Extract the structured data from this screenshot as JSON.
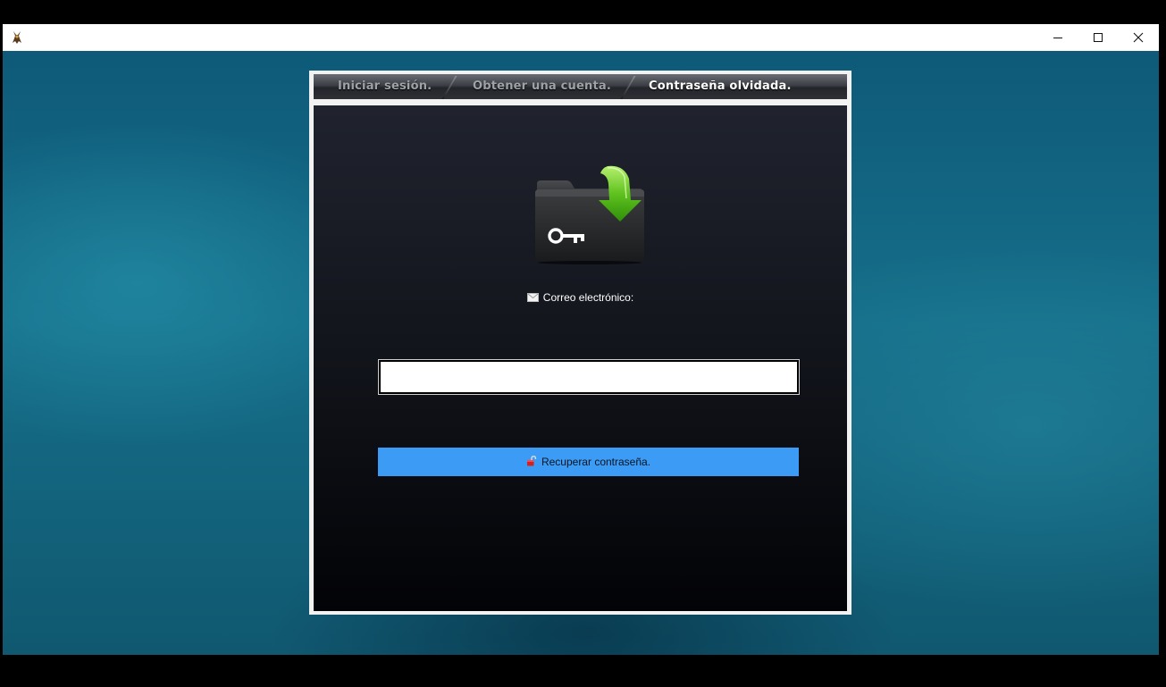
{
  "window": {
    "controls": {
      "minimize_icon": "minimize-icon",
      "maximize_icon": "maximize-icon",
      "close_icon": "close-icon"
    }
  },
  "tabs": [
    {
      "label": "Iniciar sesión.",
      "active": false
    },
    {
      "label": "Obtener una cuenta.",
      "active": false
    },
    {
      "label": "Contraseña olvidada.",
      "active": true
    }
  ],
  "form": {
    "folder_icon": "folder-key-download-icon",
    "email_label": "Correo electrónico:",
    "email_value": "",
    "email_placeholder": "",
    "submit_label": "Recuperar contraseña."
  },
  "colors": {
    "accent_button": "#3c9cf5",
    "active_tab_text": "#ffffff",
    "inactive_tab_text": "#9ea3a8"
  }
}
